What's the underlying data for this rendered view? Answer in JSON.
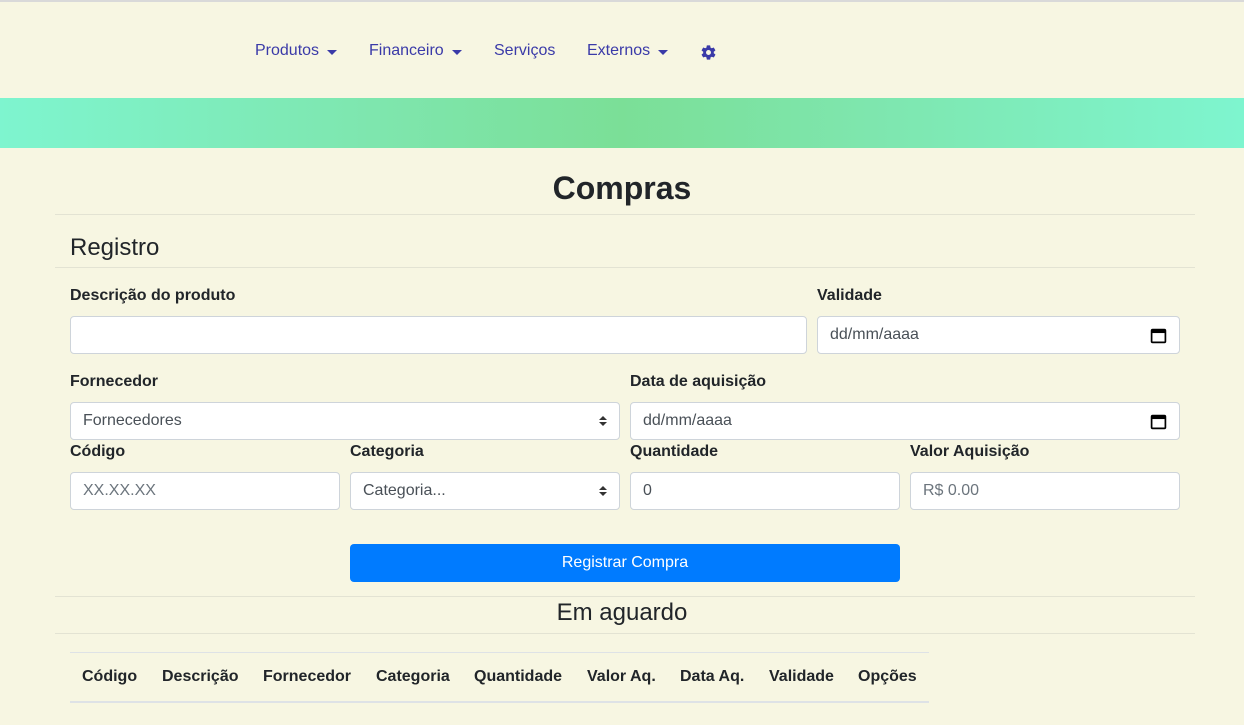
{
  "nav": {
    "items": [
      {
        "label": "Produtos",
        "dropdown": true
      },
      {
        "label": "Financeiro",
        "dropdown": true
      },
      {
        "label": "Serviços",
        "dropdown": false
      },
      {
        "label": "Externos",
        "dropdown": true
      }
    ],
    "settings_icon": "gear-icon"
  },
  "page": {
    "title": "Compras"
  },
  "registro": {
    "title": "Registro",
    "descricao": {
      "label": "Descrição do produto",
      "value": ""
    },
    "validade": {
      "label": "Validade",
      "placeholder": "dd/mm/aaaa"
    },
    "fornecedor": {
      "label": "Fornecedor",
      "selected": "Fornecedores"
    },
    "data_aquisicao": {
      "label": "Data de aquisição",
      "placeholder": "dd/mm/aaaa"
    },
    "codigo": {
      "label": "Código",
      "placeholder": "XX.XX.XX"
    },
    "categoria": {
      "label": "Categoria",
      "selected": "Categoria..."
    },
    "quantidade": {
      "label": "Quantidade",
      "value": "0"
    },
    "valor": {
      "label": "Valor Aquisição",
      "placeholder": "R$ 0.00"
    },
    "submit_label": "Registrar Compra"
  },
  "aguardo": {
    "title": "Em aguardo",
    "columns": [
      "Código",
      "Descrição",
      "Fornecedor",
      "Categoria",
      "Quantidade",
      "Valor Aq.",
      "Data Aq.",
      "Validade",
      "Opções"
    ]
  },
  "colors": {
    "background": "#f7f6e2",
    "nav_link": "#3a3aa8",
    "primary": "#007bff",
    "banner": "#7bdf97"
  }
}
